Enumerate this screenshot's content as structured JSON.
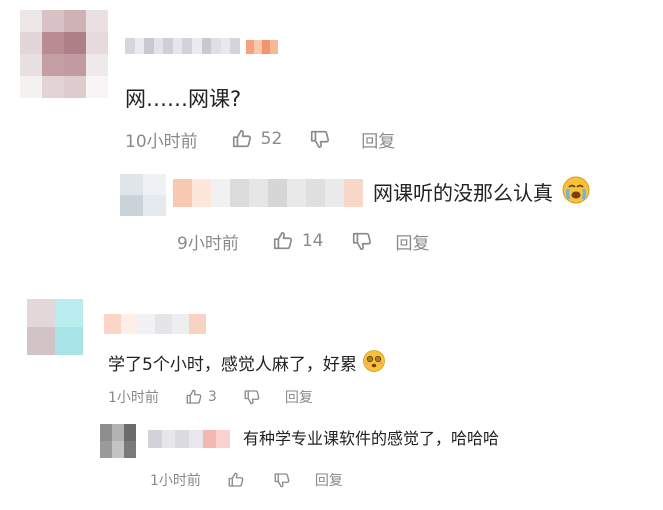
{
  "comments": [
    {
      "text": "网……网课?",
      "time": "10小时前",
      "likes": "52",
      "reply_label": "回复",
      "replies": [
        {
          "text": "网课听的没那么认真",
          "emoji": "crying-face-icon",
          "time": "9小时前",
          "likes": "14",
          "reply_label": "回复"
        }
      ]
    },
    {
      "text": "学了5个小时，感觉人麻了，好累",
      "emoji": "dizzy-face-icon",
      "time": "1小时前",
      "likes": "3",
      "reply_label": "回复",
      "replies": [
        {
          "text": "有种学专业课软件的感觉了，哈哈哈",
          "time": "1小时前",
          "likes": "",
          "reply_label": "回复"
        }
      ]
    }
  ],
  "colors": {
    "meta_text": "#8a8a8a",
    "body_text": "#222222",
    "emoji_yellow": "#f7c23a",
    "mosaic_orange": "#f5a07e"
  }
}
